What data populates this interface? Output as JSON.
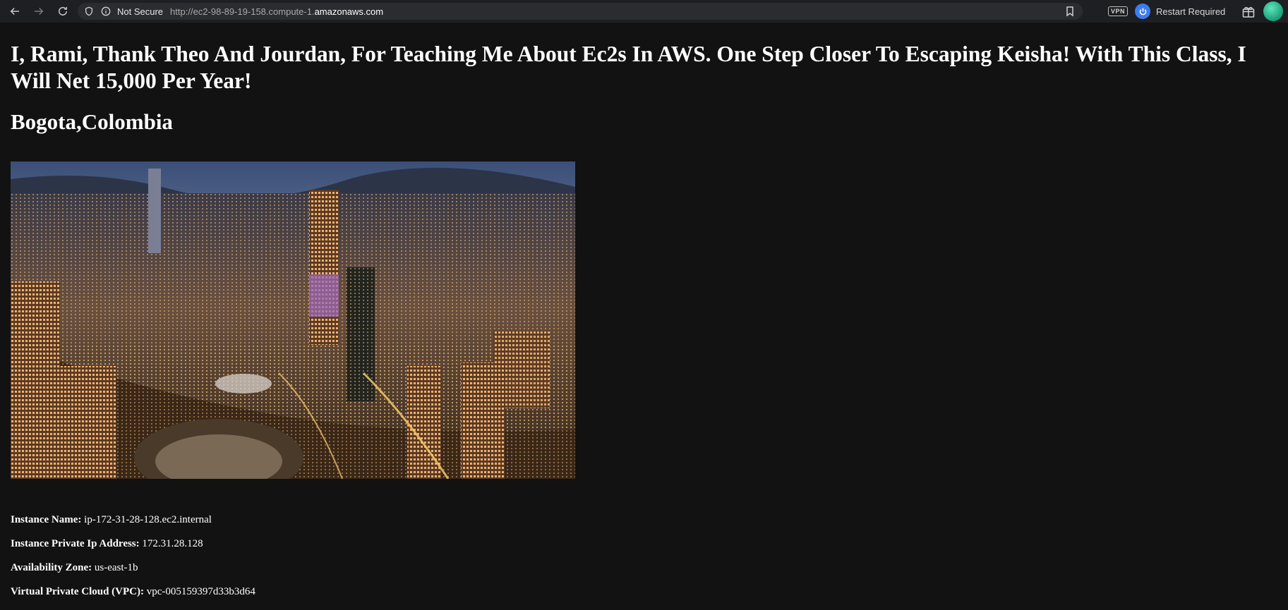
{
  "browser": {
    "security_label": "Not Secure",
    "url_prefix": "http://ec2-98-89-19-158.compute-1.",
    "url_host": "amazonaws.com",
    "vpn_label": "VPN",
    "restart_label": "Restart Required"
  },
  "page": {
    "heading": "I, Rami, Thank Theo And Jourdan, For Teaching Me About Ec2s In AWS. One Step Closer To Escaping Keisha! With This Class, I Will Net 15,000 Per Year!",
    "location": "Bogota,Colombia",
    "info": [
      {
        "label": "Instance Name:",
        "value": "ip-172-31-28-128.ec2.internal"
      },
      {
        "label": "Instance Private Ip Address:",
        "value": "172.31.28.128"
      },
      {
        "label": "Availability Zone:",
        "value": "us-east-1b"
      },
      {
        "label": "Virtual Private Cloud (VPC):",
        "value": "vpc-005159397d33b3d64"
      }
    ]
  }
}
